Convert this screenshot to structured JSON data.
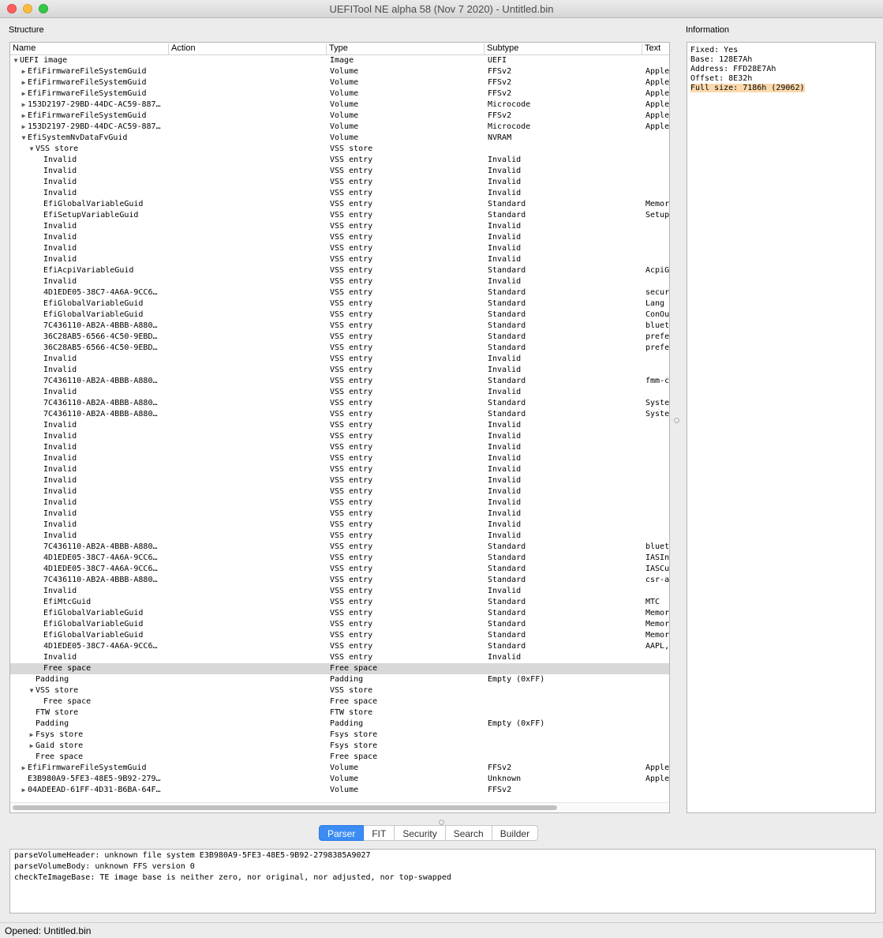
{
  "window": {
    "title": "UEFITool NE alpha 58 (Nov  7 2020) - Untitled.bin"
  },
  "structure_label": "Structure",
  "information_label": "Information",
  "columns": [
    "Name",
    "Action",
    "Type",
    "Subtype",
    "Text"
  ],
  "rows": [
    {
      "name": "UEFI image",
      "depth": 0,
      "expander": "open",
      "type": "Image",
      "subtype": "UEFI",
      "text": ""
    },
    {
      "name": "EfiFirmwareFileSystemGuid",
      "depth": 1,
      "expander": "closed",
      "type": "Volume",
      "subtype": "FFSv2",
      "text": "Apple"
    },
    {
      "name": "EfiFirmwareFileSystemGuid",
      "depth": 1,
      "expander": "closed",
      "type": "Volume",
      "subtype": "FFSv2",
      "text": "Apple"
    },
    {
      "name": "EfiFirmwareFileSystemGuid",
      "depth": 1,
      "expander": "closed",
      "type": "Volume",
      "subtype": "FFSv2",
      "text": "Apple"
    },
    {
      "name": "153D2197-29BD-44DC-AC59-887…",
      "depth": 1,
      "expander": "closed",
      "type": "Volume",
      "subtype": "Microcode",
      "text": "Apple"
    },
    {
      "name": "EfiFirmwareFileSystemGuid",
      "depth": 1,
      "expander": "closed",
      "type": "Volume",
      "subtype": "FFSv2",
      "text": "Apple"
    },
    {
      "name": "153D2197-29BD-44DC-AC59-887…",
      "depth": 1,
      "expander": "closed",
      "type": "Volume",
      "subtype": "Microcode",
      "text": "Apple"
    },
    {
      "name": "EfiSystemNvDataFvGuid",
      "depth": 1,
      "expander": "open",
      "type": "Volume",
      "subtype": "NVRAM",
      "text": ""
    },
    {
      "name": "VSS store",
      "depth": 2,
      "expander": "open",
      "type": "VSS store",
      "subtype": "",
      "text": ""
    },
    {
      "name": "Invalid",
      "depth": 3,
      "expander": "",
      "type": "VSS entry",
      "subtype": "Invalid",
      "text": ""
    },
    {
      "name": "Invalid",
      "depth": 3,
      "expander": "",
      "type": "VSS entry",
      "subtype": "Invalid",
      "text": ""
    },
    {
      "name": "Invalid",
      "depth": 3,
      "expander": "",
      "type": "VSS entry",
      "subtype": "Invalid",
      "text": ""
    },
    {
      "name": "Invalid",
      "depth": 3,
      "expander": "",
      "type": "VSS entry",
      "subtype": "Invalid",
      "text": ""
    },
    {
      "name": "EfiGlobalVariableGuid",
      "depth": 3,
      "expander": "",
      "type": "VSS entry",
      "subtype": "Standard",
      "text": "Memor"
    },
    {
      "name": "EfiSetupVariableGuid",
      "depth": 3,
      "expander": "",
      "type": "VSS entry",
      "subtype": "Standard",
      "text": "Setup"
    },
    {
      "name": "Invalid",
      "depth": 3,
      "expander": "",
      "type": "VSS entry",
      "subtype": "Invalid",
      "text": ""
    },
    {
      "name": "Invalid",
      "depth": 3,
      "expander": "",
      "type": "VSS entry",
      "subtype": "Invalid",
      "text": ""
    },
    {
      "name": "Invalid",
      "depth": 3,
      "expander": "",
      "type": "VSS entry",
      "subtype": "Invalid",
      "text": ""
    },
    {
      "name": "Invalid",
      "depth": 3,
      "expander": "",
      "type": "VSS entry",
      "subtype": "Invalid",
      "text": ""
    },
    {
      "name": "EfiAcpiVariableGuid",
      "depth": 3,
      "expander": "",
      "type": "VSS entry",
      "subtype": "Standard",
      "text": "AcpiG"
    },
    {
      "name": "Invalid",
      "depth": 3,
      "expander": "",
      "type": "VSS entry",
      "subtype": "Invalid",
      "text": ""
    },
    {
      "name": "4D1EDE05-38C7-4A6A-9CC6…",
      "depth": 3,
      "expander": "",
      "type": "VSS entry",
      "subtype": "Standard",
      "text": "secur"
    },
    {
      "name": "EfiGlobalVariableGuid",
      "depth": 3,
      "expander": "",
      "type": "VSS entry",
      "subtype": "Standard",
      "text": "Lang"
    },
    {
      "name": "EfiGlobalVariableGuid",
      "depth": 3,
      "expander": "",
      "type": "VSS entry",
      "subtype": "Standard",
      "text": "ConOu"
    },
    {
      "name": "7C436110-AB2A-4BBB-A880…",
      "depth": 3,
      "expander": "",
      "type": "VSS entry",
      "subtype": "Standard",
      "text": "bluet"
    },
    {
      "name": "36C28AB5-6566-4C50-9EBD…",
      "depth": 3,
      "expander": "",
      "type": "VSS entry",
      "subtype": "Standard",
      "text": "prefe"
    },
    {
      "name": "36C28AB5-6566-4C50-9EBD…",
      "depth": 3,
      "expander": "",
      "type": "VSS entry",
      "subtype": "Standard",
      "text": "prefe"
    },
    {
      "name": "Invalid",
      "depth": 3,
      "expander": "",
      "type": "VSS entry",
      "subtype": "Invalid",
      "text": ""
    },
    {
      "name": "Invalid",
      "depth": 3,
      "expander": "",
      "type": "VSS entry",
      "subtype": "Invalid",
      "text": ""
    },
    {
      "name": "7C436110-AB2A-4BBB-A880…",
      "depth": 3,
      "expander": "",
      "type": "VSS entry",
      "subtype": "Standard",
      "text": "fmm-c"
    },
    {
      "name": "Invalid",
      "depth": 3,
      "expander": "",
      "type": "VSS entry",
      "subtype": "Invalid",
      "text": ""
    },
    {
      "name": "7C436110-AB2A-4BBB-A880…",
      "depth": 3,
      "expander": "",
      "type": "VSS entry",
      "subtype": "Standard",
      "text": "Syste"
    },
    {
      "name": "7C436110-AB2A-4BBB-A880…",
      "depth": 3,
      "expander": "",
      "type": "VSS entry",
      "subtype": "Standard",
      "text": "Syste"
    },
    {
      "name": "Invalid",
      "depth": 3,
      "expander": "",
      "type": "VSS entry",
      "subtype": "Invalid",
      "text": ""
    },
    {
      "name": "Invalid",
      "depth": 3,
      "expander": "",
      "type": "VSS entry",
      "subtype": "Invalid",
      "text": ""
    },
    {
      "name": "Invalid",
      "depth": 3,
      "expander": "",
      "type": "VSS entry",
      "subtype": "Invalid",
      "text": ""
    },
    {
      "name": "Invalid",
      "depth": 3,
      "expander": "",
      "type": "VSS entry",
      "subtype": "Invalid",
      "text": ""
    },
    {
      "name": "Invalid",
      "depth": 3,
      "expander": "",
      "type": "VSS entry",
      "subtype": "Invalid",
      "text": ""
    },
    {
      "name": "Invalid",
      "depth": 3,
      "expander": "",
      "type": "VSS entry",
      "subtype": "Invalid",
      "text": ""
    },
    {
      "name": "Invalid",
      "depth": 3,
      "expander": "",
      "type": "VSS entry",
      "subtype": "Invalid",
      "text": ""
    },
    {
      "name": "Invalid",
      "depth": 3,
      "expander": "",
      "type": "VSS entry",
      "subtype": "Invalid",
      "text": ""
    },
    {
      "name": "Invalid",
      "depth": 3,
      "expander": "",
      "type": "VSS entry",
      "subtype": "Invalid",
      "text": ""
    },
    {
      "name": "Invalid",
      "depth": 3,
      "expander": "",
      "type": "VSS entry",
      "subtype": "Invalid",
      "text": ""
    },
    {
      "name": "Invalid",
      "depth": 3,
      "expander": "",
      "type": "VSS entry",
      "subtype": "Invalid",
      "text": ""
    },
    {
      "name": "7C436110-AB2A-4BBB-A880…",
      "depth": 3,
      "expander": "",
      "type": "VSS entry",
      "subtype": "Standard",
      "text": "bluet"
    },
    {
      "name": "4D1EDE05-38C7-4A6A-9CC6…",
      "depth": 3,
      "expander": "",
      "type": "VSS entry",
      "subtype": "Standard",
      "text": "IASIn"
    },
    {
      "name": "4D1EDE05-38C7-4A6A-9CC6…",
      "depth": 3,
      "expander": "",
      "type": "VSS entry",
      "subtype": "Standard",
      "text": "IASCu"
    },
    {
      "name": "7C436110-AB2A-4BBB-A880…",
      "depth": 3,
      "expander": "",
      "type": "VSS entry",
      "subtype": "Standard",
      "text": "csr-a"
    },
    {
      "name": "Invalid",
      "depth": 3,
      "expander": "",
      "type": "VSS entry",
      "subtype": "Invalid",
      "text": ""
    },
    {
      "name": "EfiMtcGuid",
      "depth": 3,
      "expander": "",
      "type": "VSS entry",
      "subtype": "Standard",
      "text": "MTC"
    },
    {
      "name": "EfiGlobalVariableGuid",
      "depth": 3,
      "expander": "",
      "type": "VSS entry",
      "subtype": "Standard",
      "text": "Memor"
    },
    {
      "name": "EfiGlobalVariableGuid",
      "depth": 3,
      "expander": "",
      "type": "VSS entry",
      "subtype": "Standard",
      "text": "Memor"
    },
    {
      "name": "EfiGlobalVariableGuid",
      "depth": 3,
      "expander": "",
      "type": "VSS entry",
      "subtype": "Standard",
      "text": "Memor"
    },
    {
      "name": "4D1EDE05-38C7-4A6A-9CC6…",
      "depth": 3,
      "expander": "",
      "type": "VSS entry",
      "subtype": "Standard",
      "text": "AAPL,"
    },
    {
      "name": "Invalid",
      "depth": 3,
      "expander": "",
      "type": "VSS entry",
      "subtype": "Invalid",
      "text": ""
    },
    {
      "name": "Free space",
      "depth": 3,
      "expander": "",
      "type": "Free space",
      "subtype": "",
      "text": "",
      "selected": true
    },
    {
      "name": "Padding",
      "depth": 2,
      "expander": "",
      "type": "Padding",
      "subtype": "Empty (0xFF)",
      "text": ""
    },
    {
      "name": "VSS store",
      "depth": 2,
      "expander": "open",
      "type": "VSS store",
      "subtype": "",
      "text": ""
    },
    {
      "name": "Free space",
      "depth": 3,
      "expander": "",
      "type": "Free space",
      "subtype": "",
      "text": ""
    },
    {
      "name": "FTW store",
      "depth": 2,
      "expander": "",
      "type": "FTW store",
      "subtype": "",
      "text": ""
    },
    {
      "name": "Padding",
      "depth": 2,
      "expander": "",
      "type": "Padding",
      "subtype": "Empty (0xFF)",
      "text": ""
    },
    {
      "name": "Fsys store",
      "depth": 2,
      "expander": "closed",
      "type": "Fsys store",
      "subtype": "",
      "text": ""
    },
    {
      "name": "Gaid store",
      "depth": 2,
      "expander": "closed",
      "type": "Fsys store",
      "subtype": "",
      "text": ""
    },
    {
      "name": "Free space",
      "depth": 2,
      "expander": "",
      "type": "Free space",
      "subtype": "",
      "text": ""
    },
    {
      "name": "EfiFirmwareFileSystemGuid",
      "depth": 1,
      "expander": "closed",
      "type": "Volume",
      "subtype": "FFSv2",
      "text": "Apple"
    },
    {
      "name": "E3B980A9-5FE3-48E5-9B92-279…",
      "depth": 1,
      "expander": "",
      "type": "Volume",
      "subtype": "Unknown",
      "text": "Apple"
    },
    {
      "name": "04ADEEAD-61FF-4D31-B6BA-64F…",
      "depth": 1,
      "expander": "closed",
      "type": "Volume",
      "subtype": "FFSv2",
      "text": ""
    }
  ],
  "information": [
    {
      "text": "Fixed: Yes",
      "highlight": false
    },
    {
      "text": "Base: 128E7Ah",
      "highlight": false
    },
    {
      "text": "Address: FFD28E7Ah",
      "highlight": false
    },
    {
      "text": "Offset: 8E32h",
      "highlight": false
    },
    {
      "text": "Full size: 7186h (29062)",
      "highlight": true
    }
  ],
  "tabs": [
    {
      "label": "Parser",
      "active": true
    },
    {
      "label": "FIT",
      "active": false
    },
    {
      "label": "Security",
      "active": false
    },
    {
      "label": "Search",
      "active": false
    },
    {
      "label": "Builder",
      "active": false
    }
  ],
  "messages": [
    "parseVolumeHeader: unknown file system E3B980A9-5FE3-48E5-9B92-2798385A9027",
    "parseVolumeBody: unknown FFS version 0",
    "checkTeImageBase: TE image base is neither zero, nor original, nor adjusted, nor top-swapped"
  ],
  "status": "Opened: Untitled.bin",
  "colors": {
    "selection": "#d8d8d8",
    "highlight": "#fbd9ad",
    "tab_active": "#3b8cf4"
  }
}
